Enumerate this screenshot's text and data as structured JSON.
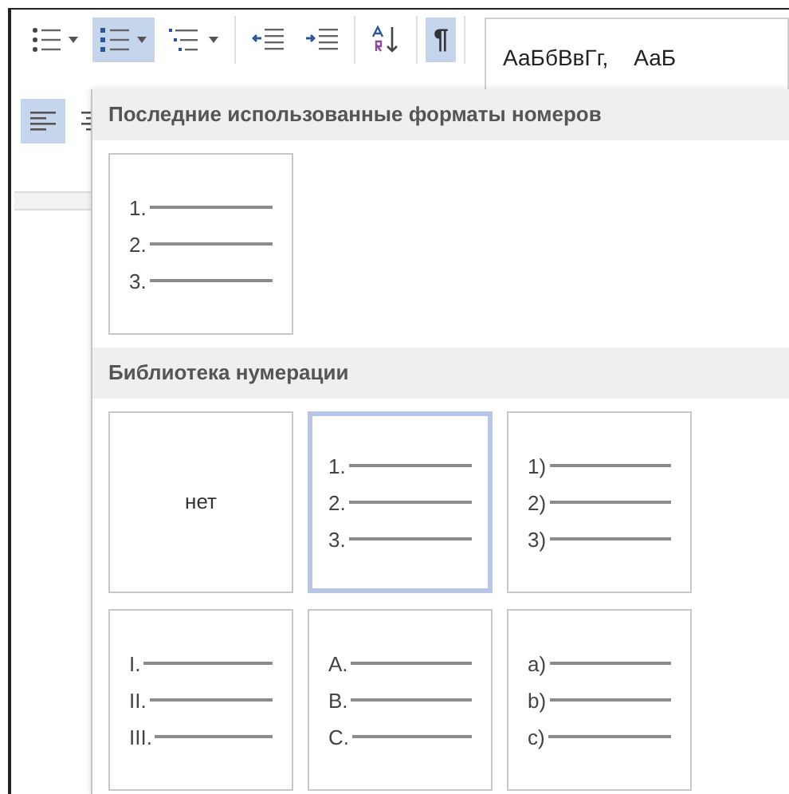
{
  "toolbar": {
    "buttons": [
      {
        "kind": "bullets",
        "selected": false,
        "dropdown": true
      },
      {
        "kind": "numbering",
        "selected": true,
        "dropdown": true
      },
      {
        "kind": "multilevel",
        "selected": false,
        "dropdown": true
      },
      {
        "kind": "outdent",
        "selected": false,
        "dropdown": false
      },
      {
        "kind": "indent",
        "selected": false,
        "dropdown": false
      },
      {
        "kind": "sort",
        "selected": false,
        "dropdown": false
      },
      {
        "kind": "pilcrow",
        "selected": true,
        "dropdown": false,
        "text": "¶"
      }
    ],
    "styles": [
      "АаБбВвГг,",
      "АаБ"
    ],
    "align_buttons": [
      {
        "kind": "align-left",
        "selected": true
      },
      {
        "kind": "center",
        "selected": false
      }
    ]
  },
  "menu": {
    "sections": [
      {
        "title": "Последние использованные форматы номеров",
        "tiles": [
          {
            "kind": "list",
            "selected": false,
            "labels": [
              "1.",
              "2.",
              "3."
            ]
          }
        ]
      },
      {
        "title": "Библиотека нумерации",
        "tiles": [
          {
            "kind": "none",
            "selected": false,
            "text": "нет"
          },
          {
            "kind": "list",
            "selected": true,
            "labels": [
              "1.",
              "2.",
              "3."
            ]
          },
          {
            "kind": "list",
            "selected": false,
            "labels": [
              "1)",
              "2)",
              "3)"
            ]
          },
          {
            "kind": "list",
            "selected": false,
            "labels": [
              "I.",
              "II.",
              "III."
            ]
          },
          {
            "kind": "list",
            "selected": false,
            "labels": [
              "A.",
              "B.",
              "C."
            ]
          },
          {
            "kind": "list",
            "selected": false,
            "labels": [
              "a)",
              "b)",
              "c)"
            ]
          }
        ]
      }
    ]
  }
}
